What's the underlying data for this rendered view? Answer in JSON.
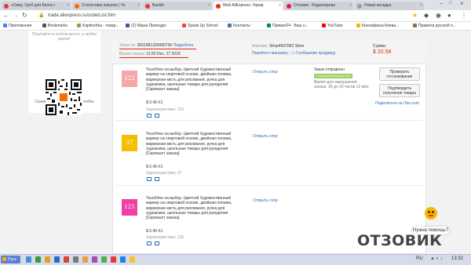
{
  "browser": {
    "tabs": [
      {
        "label": "«Свер. Гроб для Белос»",
        "color": "#e53935"
      },
      {
        "label": "Статистика покупок | Ya",
        "color": "#ef6c00"
      },
      {
        "label": "Backlit",
        "color": "#e53935"
      },
      {
        "label": "Мой AliExpress: Управ",
        "color": "#e62e04"
      },
      {
        "label": "Отзовик - Редактирова",
        "color": "#d81b60"
      },
      {
        "label": "Новая вкладка",
        "color": "#9e9e9e"
      }
    ],
    "url": "trade.aliexpress.ru/orderList.htm",
    "bookmarks": [
      "Приложения",
      "Bookmarks",
      "Kapitoshka - товар...",
      "(2) Маша Приходко",
      "Speak Up School",
      "Контакты",
      "Привал24 - Ваш н...",
      "YouTube",
      "Киноафиша Киева...",
      "Правила русской о..."
    ]
  },
  "sidebar": {
    "top_text": "Покупайте в любом месте, в любое время!",
    "caption": "Сканируйте или нажмите, чтобы скачать"
  },
  "order": {
    "number_label": "Заказ №:",
    "number": "3001981326680756",
    "details_link": "Подробнее",
    "time_label": "Время заказа:",
    "time": "11:55 Dec. 17 2019",
    "store_label": "Магазин:",
    "store": "Shop4697062 Store",
    "goto_store": "Перейти к магазину",
    "message_seller": "Сообщение продавцу",
    "sum_label": "Сумма:",
    "sum": "$ 20.58",
    "status": "Заказ отправлен",
    "status_badge": "с надёжной ведомостью",
    "status_note": "Время для завершения заказа: 35 дн 20 часов 12 мин",
    "btn_track": "Проверить отслеживание",
    "btn_confirm": "Подтвердить получение товара",
    "similar": "Поделиться на iTao.com"
  },
  "items": [
    {
      "thumb_text": "122",
      "thumb_color": "#f4a9a6",
      "desc": "Touchfree на выбор, Цветной Художественный маркер на спиртовой основе, двойная головка, маркерная кисть для рисования, ручка для художника, школьные товары для рукоделия",
      "snapshot": "[Скриншот заказа]",
      "price": "$ 0.49 X1",
      "attrs": "Характеристики: 122",
      "dispute": "Открыть спор"
    },
    {
      "thumb_text": "37",
      "thumb_color": "#f5be00",
      "desc": "Touchfree на выбор, Цветной Художественный маркер на спиртовой основе, двойная головка, маркерная кисть для рисования, ручка для художника, школьные товары для рукоделия",
      "snapshot": "[Скриншот заказа]",
      "price": "$ 0.49 X1",
      "attrs": "Характеристики: 37",
      "dispute": "Открыть спор"
    },
    {
      "thumb_text": "125",
      "thumb_color": "#f03fa6",
      "desc": "Touchfree на выбор, Цветной Художественный маркер на спиртовой основе, двойная головка, маркерная кисть для рисования, ручка для художника, школьные товары для рукоделия",
      "snapshot": "[Скриншот заказа]",
      "price": "$ 0.49 X1",
      "attrs": "Характеристики: 125",
      "dispute": "Открыть спор"
    }
  ],
  "help": {
    "label": "Нужна помощь?"
  },
  "watermark": "ОТЗОВИК",
  "taskbar": {
    "start": "Пуск",
    "lang": "RU",
    "time": "13:32"
  }
}
